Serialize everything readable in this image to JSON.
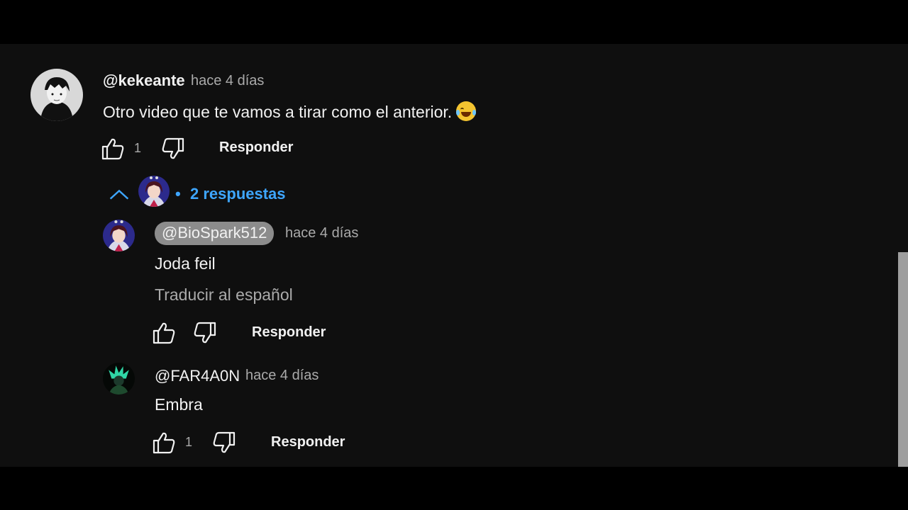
{
  "comment": {
    "author": "@kekeante",
    "time": "hace 4 días",
    "text": "Otro video que te vamos a tirar como el anterior.",
    "emoji": "face-with-tears-of-joy",
    "likes": "1",
    "reply_label": "Responder"
  },
  "replies_toggle": {
    "dot": "•",
    "label": "2 respuestas",
    "chevron": "chevron-up-icon"
  },
  "replies": [
    {
      "author": "@BioSpark512",
      "time": "hace 4 días",
      "text": "Joda feil",
      "translate": "Traducir al español",
      "likes": "",
      "reply_label": "Responder"
    },
    {
      "author": "@FAR4A0N",
      "time": "hace 4 días",
      "text": "Embra",
      "likes": "1",
      "reply_label": "Responder"
    }
  ],
  "colors": {
    "background": "#0f0f0f",
    "link_blue": "#3ea6ff",
    "secondary_text": "#aaaaaa",
    "pill": "#8c8c8c"
  }
}
